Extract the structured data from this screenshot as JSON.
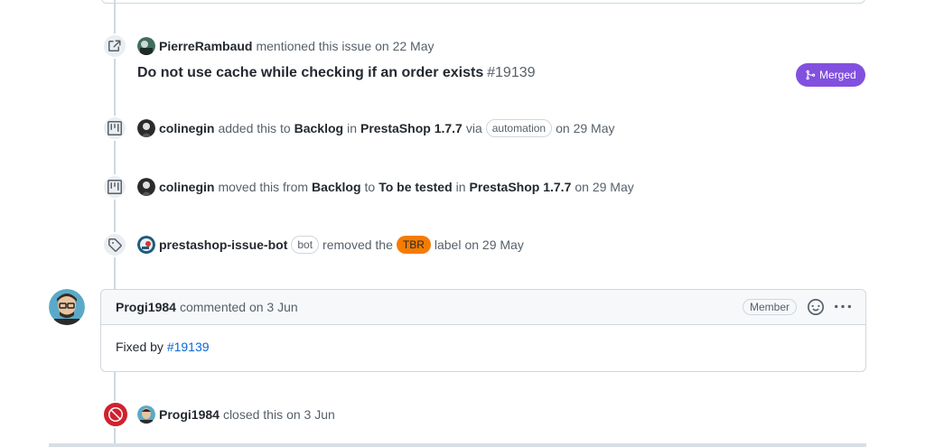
{
  "events": {
    "mention": {
      "actor": "PierreRambaud",
      "action": "mentioned this issue",
      "date": "on 22 May",
      "ref_title": "Do not use cache while checking if an order exists",
      "ref_number": "#19139",
      "status": "Merged",
      "status_color": "#8250df"
    },
    "added": {
      "actor": "colinegin",
      "text1": "added this to",
      "column": "Backlog",
      "text2": "in",
      "project": "PrestaShop 1.7.7",
      "text3": "via",
      "via": "automation",
      "date": "on 29 May"
    },
    "moved": {
      "actor": "colinegin",
      "text1": "moved this from",
      "from": "Backlog",
      "text2": "to",
      "to": "To be tested",
      "text3": "in",
      "project": "PrestaShop 1.7.7",
      "date": "on 29 May"
    },
    "label": {
      "actor": "prestashop-issue-bot",
      "bot_tag": "bot",
      "text1": "removed the",
      "label_name": "TBR",
      "label_color": "#f57c00",
      "text2": "label",
      "date": "on 29 May"
    },
    "closed": {
      "actor": "Progi1984",
      "action": "closed this",
      "date": "on 3 Jun"
    }
  },
  "comment": {
    "author": "Progi1984",
    "meta": "commented on 3 Jun",
    "role": "Member",
    "body_text": "Fixed by",
    "body_link": "#19139"
  },
  "icons": {
    "mention": "cross-reference-icon",
    "project": "project-icon",
    "label": "tag-icon",
    "closed": "skip-circle-icon",
    "reaction": "smiley-icon",
    "menu": "kebab-horizontal-icon",
    "merged": "git-merge-icon"
  }
}
